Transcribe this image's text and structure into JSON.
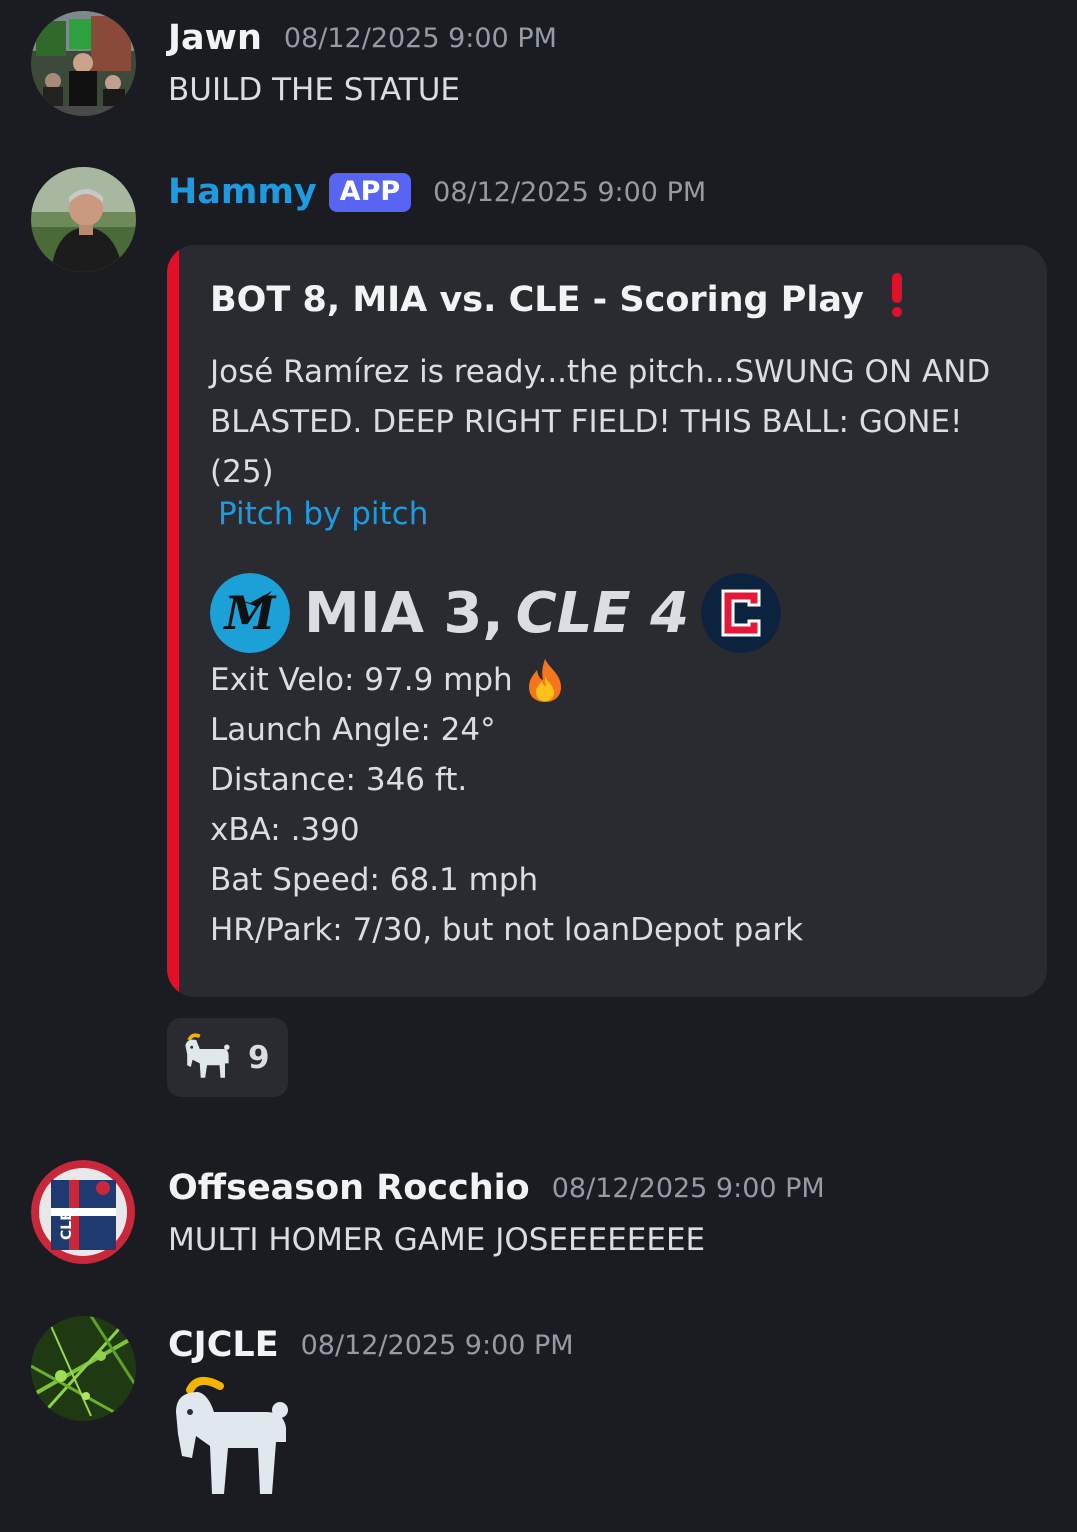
{
  "messages": [
    {
      "username": "Jawn",
      "timestamp": "08/12/2025 9:00 PM",
      "content": "BUILD THE STATUE"
    },
    {
      "username": "Hammy",
      "badge": "APP",
      "timestamp": "08/12/2025 9:00 PM",
      "embed": {
        "accent_color": "#e0102a",
        "title": "BOT 8, MIA vs. CLE - Scoring Play",
        "title_icon": "exclamation-icon",
        "description": "José Ramírez is ready...the pitch...SWUNG ON AND BLASTED. DEEP RIGHT FIELD! THIS BALL: GONE! (25)",
        "link": "Pitch by pitch",
        "score_away": "MIA 3,",
        "score_home": "CLE 4",
        "away_logo": "marlins-logo",
        "home_logo": "guardians-logo",
        "stats": [
          "Exit Velo: 97.9 mph",
          "Launch Angle: 24°",
          "Distance: 346 ft.",
          "xBA: .390",
          "Bat Speed: 68.1 mph",
          "HR/Park: 7/30, but not loanDepot park"
        ],
        "stat_icon": "fire-icon"
      },
      "reaction": {
        "emoji": "goat-icon",
        "count": "9"
      }
    },
    {
      "username": "Offseason Rocchio",
      "timestamp": "08/12/2025 9:00 PM",
      "content": "MULTI HOMER GAME JOSEEEEEEEE"
    },
    {
      "username": "CJCLE",
      "timestamp": "08/12/2025 9:00 PM",
      "content_emoji": "goat-icon"
    }
  ]
}
